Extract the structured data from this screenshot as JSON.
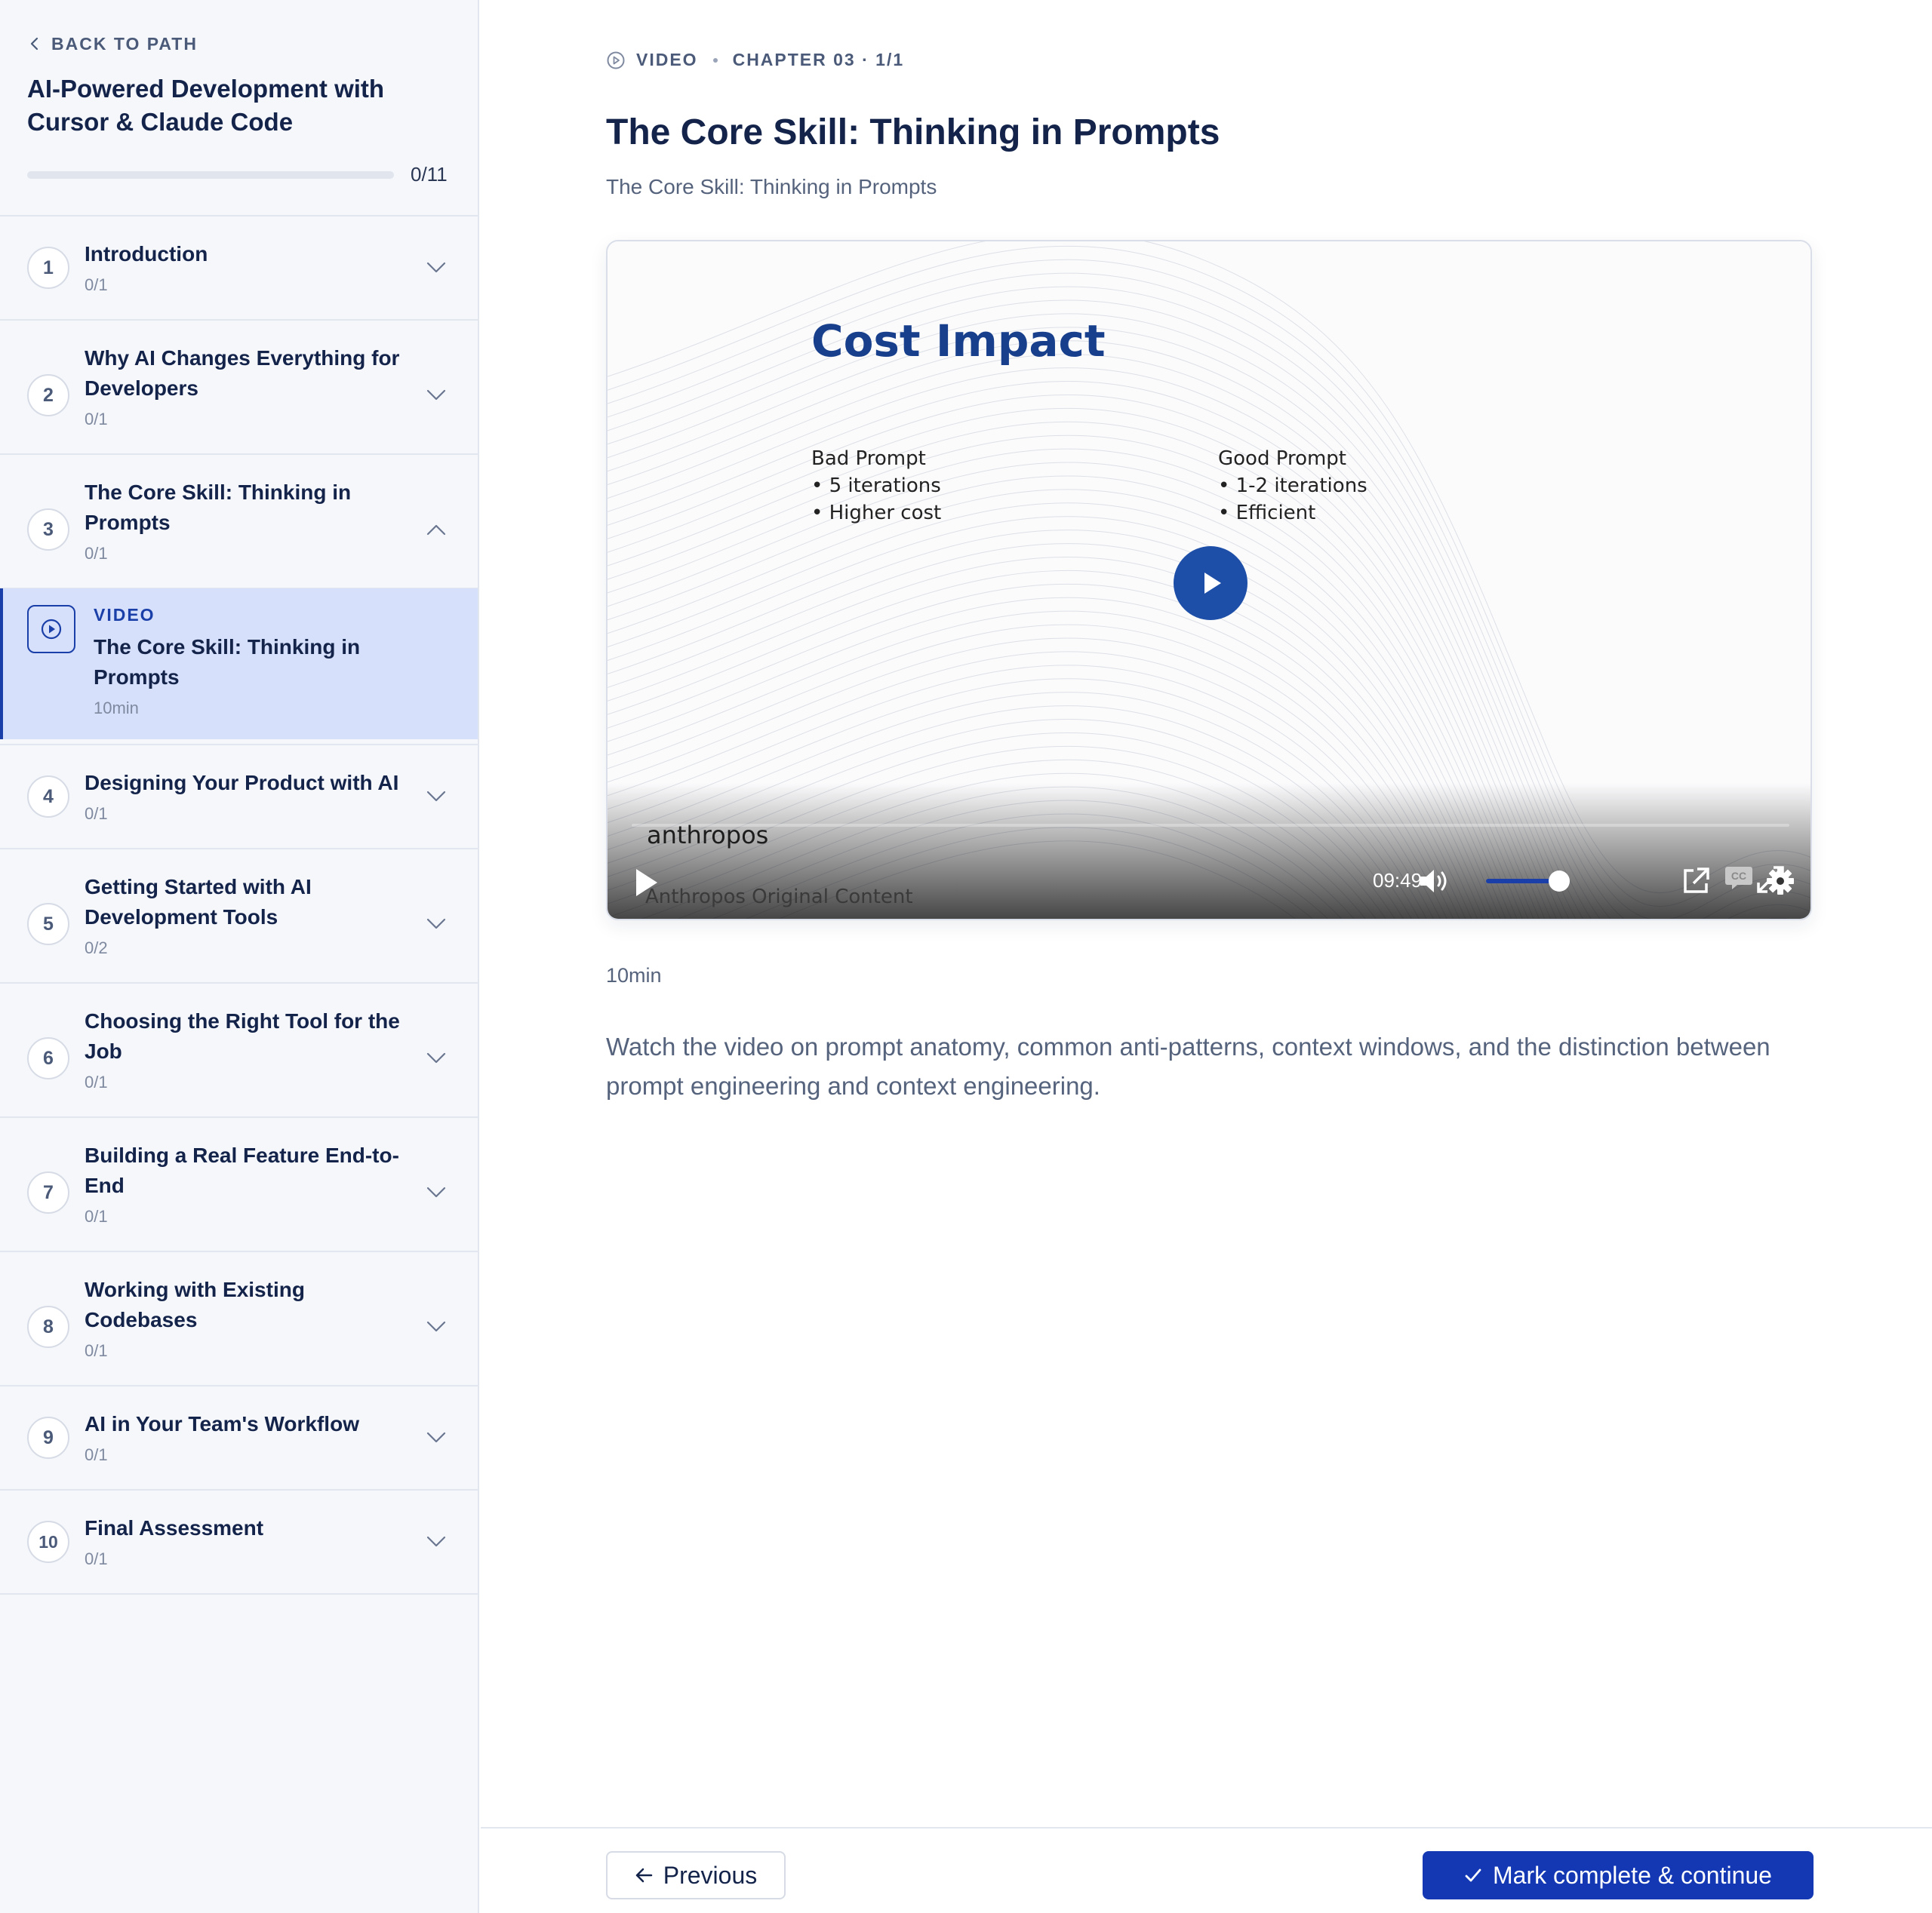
{
  "sidebar": {
    "back_label": "BACK TO PATH",
    "course_title": "AI-Powered Development with Cursor & Claude Code",
    "progress_text": "0/11",
    "progress_fraction": 0,
    "chapters": [
      {
        "number": "1",
        "title": "Introduction",
        "count": "0/1",
        "expanded": false
      },
      {
        "number": "2",
        "title": "Why AI Changes Everything for Developers",
        "count": "0/1",
        "expanded": false
      },
      {
        "number": "3",
        "title": "The Core Skill: Thinking in Prompts",
        "count": "0/1",
        "expanded": true
      },
      {
        "number": "4",
        "title": "Designing Your Product with AI",
        "count": "0/1",
        "expanded": false
      },
      {
        "number": "5",
        "title": "Getting Started with AI Development Tools",
        "count": "0/2",
        "expanded": false
      },
      {
        "number": "6",
        "title": "Choosing the Right Tool for the Job",
        "count": "0/1",
        "expanded": false
      },
      {
        "number": "7",
        "title": "Building a Real Feature End-to-End",
        "count": "0/1",
        "expanded": false
      },
      {
        "number": "8",
        "title": "Working with Existing Codebases",
        "count": "0/1",
        "expanded": false
      },
      {
        "number": "9",
        "title": "AI in Your Team's Workflow",
        "count": "0/1",
        "expanded": false
      },
      {
        "number": "10",
        "title": "Final Assessment",
        "count": "0/1",
        "expanded": false
      }
    ],
    "active_lesson": {
      "type": "VIDEO",
      "title": "The Core Skill: Thinking in Prompts",
      "duration": "10min"
    }
  },
  "main": {
    "eyebrow_type": "VIDEO",
    "eyebrow_chapter": "CHAPTER 03 · 1/1",
    "title": "The Core Skill: Thinking in Prompts",
    "subtitle": "The Core Skill: Thinking in Prompts",
    "duration": "10min",
    "description": "Watch the video on prompt anatomy, common anti-patterns, context windows, and the distinction between prompt engineering and context engineering."
  },
  "video": {
    "slide_title": "Cost Impact",
    "bad_heading": "Bad Prompt",
    "bad_items": [
      "• 5 iterations",
      "• Higher cost"
    ],
    "good_heading": "Good Prompt",
    "good_items": [
      "• 1-2 iterations",
      "• Efficient"
    ],
    "brand": "anthropos",
    "brand_sub": "Anthropos Original Content",
    "time": "09:49",
    "cc_label": "CC",
    "volume_fraction": 0.9
  },
  "footer": {
    "prev_label": "Previous",
    "next_label": "Mark complete & continue"
  },
  "colors": {
    "accent": "#1438b4",
    "active_bg": "#d6e0fa",
    "sidebar_bg": "#f5f7fb",
    "title_text": "#13234a",
    "slide_title": "#183f8c",
    "play_button": "#1e4fa8"
  }
}
